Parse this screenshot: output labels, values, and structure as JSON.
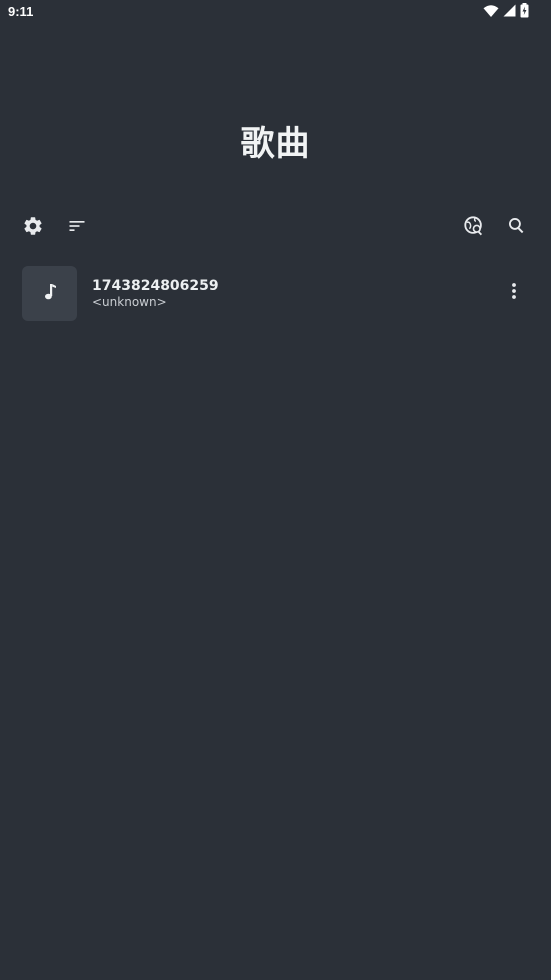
{
  "status_bar": {
    "time": "9:11",
    "icons": [
      "wifi-icon",
      "cell-signal-icon",
      "battery-icon"
    ]
  },
  "header": {
    "title": "歌曲"
  },
  "toolbar": {
    "left": [
      "settings-icon",
      "sort-icon"
    ],
    "right": [
      "scan-folder-icon",
      "search-icon"
    ]
  },
  "songs": [
    {
      "title": "1743824806259",
      "artist": "<unknown>",
      "art_icon": "music-note-icon",
      "menu_icon": "more-vert-icon"
    }
  ],
  "colors": {
    "background": "#2b3038",
    "art_background": "#3b414a",
    "text_primary": "#eceff1",
    "text_secondary": "#c9cdd2"
  }
}
